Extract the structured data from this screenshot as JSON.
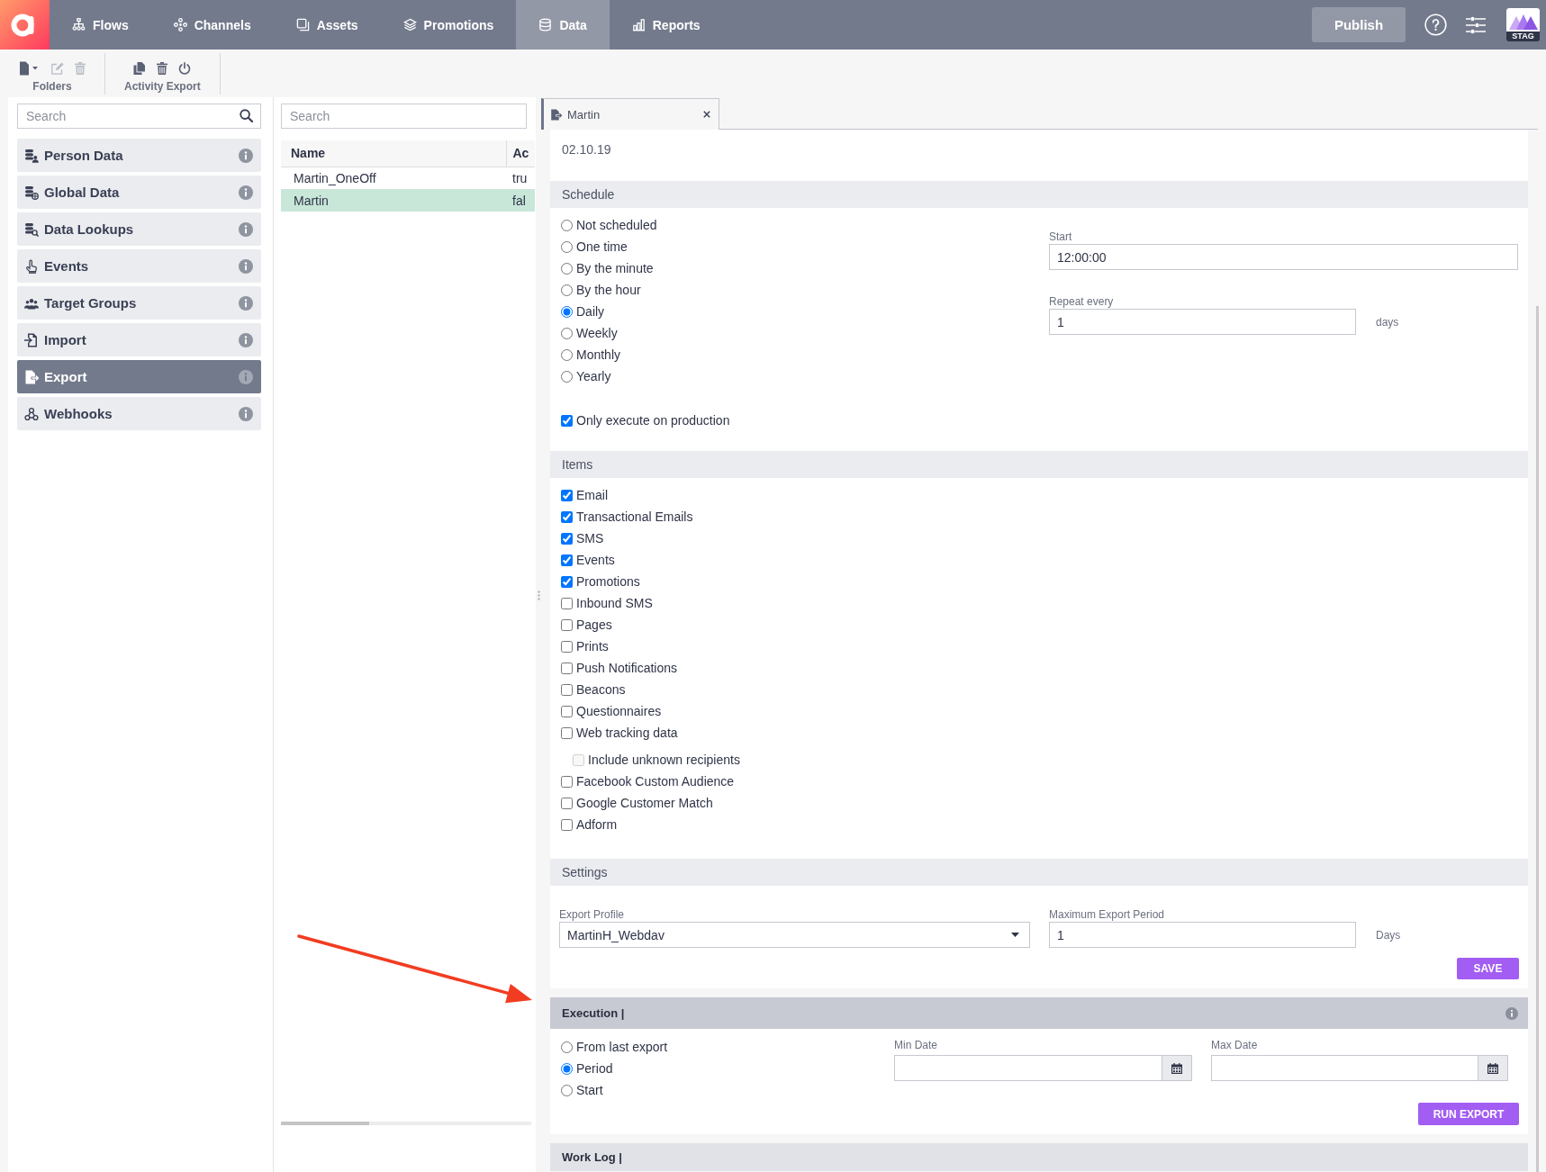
{
  "top_nav": {
    "tabs": [
      {
        "label": "Flows",
        "selected": false
      },
      {
        "label": "Channels",
        "selected": false
      },
      {
        "label": "Assets",
        "selected": false
      },
      {
        "label": "Promotions",
        "selected": false
      },
      {
        "label": "Data",
        "selected": true
      },
      {
        "label": "Reports",
        "selected": false
      }
    ],
    "publish_button": "Publish",
    "environment_badge": "STAG"
  },
  "toolbar": {
    "groups": [
      {
        "label": "Folders",
        "tools": [
          {
            "disabled": false
          },
          {
            "disabled": true
          },
          {
            "disabled": true
          }
        ]
      },
      {
        "label": "Activity Export",
        "tools": [
          {
            "disabled": false
          },
          {
            "disabled": false
          },
          {
            "disabled": false
          }
        ]
      }
    ]
  },
  "sidebar": {
    "search": {
      "placeholder": "Search"
    },
    "items": [
      {
        "label": "Person Data",
        "selected": false
      },
      {
        "label": "Global Data",
        "selected": false
      },
      {
        "label": "Data Lookups",
        "selected": false
      },
      {
        "label": "Events",
        "selected": false
      },
      {
        "label": "Target Groups",
        "selected": false
      },
      {
        "label": "Import",
        "selected": false
      },
      {
        "label": "Export",
        "selected": true
      },
      {
        "label": "Webhooks",
        "selected": false
      }
    ]
  },
  "list_panel": {
    "search": {
      "placeholder": "Search"
    },
    "table": {
      "columns": [
        "Name",
        "Ac"
      ],
      "rows": [
        {
          "cells": [
            "Martin_OneOff",
            "tru"
          ],
          "selected": false
        },
        {
          "cells": [
            "Martin",
            "fal"
          ],
          "selected": true
        }
      ]
    }
  },
  "editor": {
    "tabs": [
      {
        "label": "Martin",
        "selected": true
      }
    ],
    "date": "02.10.19",
    "schedule": {
      "title": "Schedule",
      "options": [
        {
          "label": "Not scheduled",
          "selected": false
        },
        {
          "label": "One time",
          "selected": false
        },
        {
          "label": "By the minute",
          "selected": false
        },
        {
          "label": "By the hour",
          "selected": false
        },
        {
          "label": "Daily",
          "selected": true
        },
        {
          "label": "Weekly",
          "selected": false
        },
        {
          "label": "Monthly",
          "selected": false
        },
        {
          "label": "Yearly",
          "selected": false
        }
      ],
      "start": {
        "label": "Start",
        "value": "12:00:00"
      },
      "repeat": {
        "label": "Repeat every",
        "value": "1",
        "unit": "days"
      },
      "production_only": {
        "label": "Only execute on production",
        "checked": true
      }
    },
    "items": {
      "title": "Items",
      "options": [
        {
          "label": "Email",
          "checked": true
        },
        {
          "label": "Transactional Emails",
          "checked": true
        },
        {
          "label": "SMS",
          "checked": true
        },
        {
          "label": "Events",
          "checked": true
        },
        {
          "label": "Promotions",
          "checked": true
        },
        {
          "label": "Inbound SMS",
          "checked": false
        },
        {
          "label": "Pages",
          "checked": false
        },
        {
          "label": "Prints",
          "checked": false
        },
        {
          "label": "Push Notifications",
          "checked": false
        },
        {
          "label": "Beacons",
          "checked": false
        },
        {
          "label": "Questionnaires",
          "checked": false
        },
        {
          "label": "Web tracking data",
          "checked": false,
          "children": [
            {
              "label": "Include unknown recipients",
              "checked": false,
              "disabled": true
            }
          ]
        },
        {
          "label": "Facebook Custom Audience",
          "checked": false
        },
        {
          "label": "Google Customer Match",
          "checked": false
        },
        {
          "label": "Adform",
          "checked": false
        }
      ]
    },
    "settings": {
      "title": "Settings",
      "export_profile": {
        "label": "Export Profile",
        "value": "MartinH_Webdav"
      },
      "max_period": {
        "label": "Maximum Export Period",
        "value": "1",
        "unit": "Days"
      },
      "save_button": "SAVE"
    },
    "execution": {
      "title": "Execution |",
      "options": [
        {
          "label": "From last export",
          "selected": false
        },
        {
          "label": "Period",
          "selected": true
        },
        {
          "label": "Start",
          "selected": false
        }
      ],
      "min_date": {
        "label": "Min Date"
      },
      "max_date": {
        "label": "Max Date"
      },
      "run_button": "RUN EXPORT"
    },
    "work_log": {
      "title": "Work Log |"
    }
  }
}
